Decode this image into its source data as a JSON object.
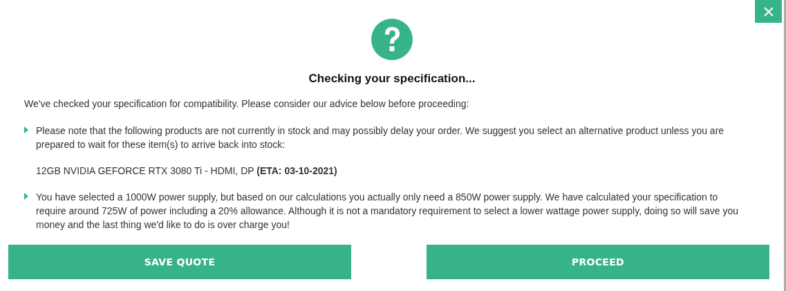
{
  "dialog": {
    "title": "Checking your specification...",
    "intro": "We've checked your specification for compatibility. Please consider our advice below before proceeding:",
    "notices": [
      {
        "text": "Please note that the following products are not currently in stock and may possibly delay your order. We suggest you select an alternative product unless you are prepared to wait for these item(s) to arrive back into stock:",
        "products": [
          "12GB NVIDIA GEFORCE RTX 3080 Ti - HDMI, DP **(ETA: 03-10-2021)**"
        ]
      },
      {
        "text": "You have selected a 1000W power supply, but based on our calculations you actually only need a 850W power supply. We have calculated your specification to require around 725W of power including a 20% allowance. Although it is not a mandatory requirement to select a lower wattage power supply, doing so will save you money and the last thing we'd like to do is over charge you!"
      }
    ],
    "buttons": [
      "SAVE QUOTE",
      "PROCEED"
    ]
  }
}
